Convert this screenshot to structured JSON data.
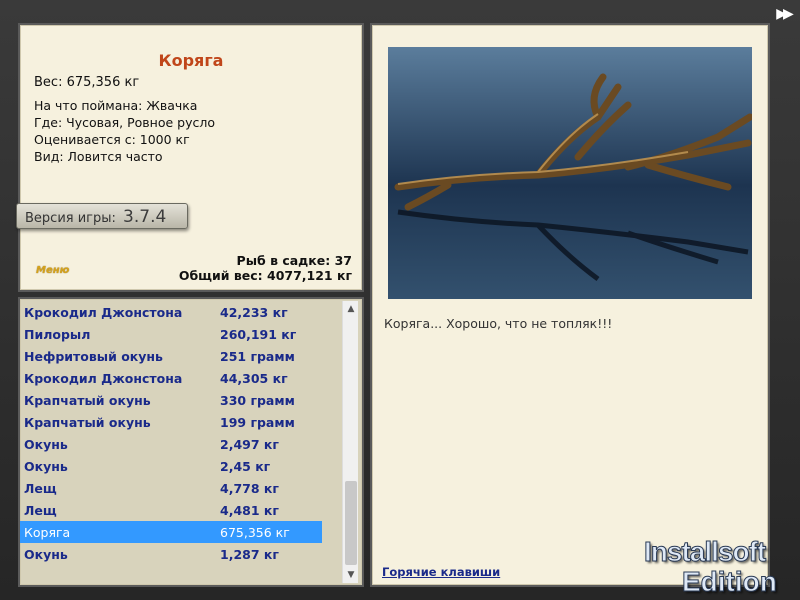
{
  "fish": {
    "name": "Коряга",
    "weight_line": "Вес: 675,356 кг",
    "attributes": [
      "На что поймана: Жвачка",
      "Где: Чусовая, Ровное русло",
      "Оценивается с: 1000 кг",
      "Вид: Ловится часто"
    ]
  },
  "version": {
    "label": "Версия игры:",
    "number": "3.7.4"
  },
  "menu_logo": "Меню",
  "stats": {
    "fish_count": "Рыб в садке: 37",
    "total_weight": "Общий вес: 4077,121 кг"
  },
  "catch_list": [
    {
      "name": "Крокодил Джонстона",
      "weight": "42,233 кг"
    },
    {
      "name": "Пилорыл",
      "weight": "260,191 кг"
    },
    {
      "name": "Нефритовый окунь",
      "weight": "251 грамм"
    },
    {
      "name": "Крокодил Джонстона",
      "weight": "44,305 кг"
    },
    {
      "name": "Крапчатый окунь",
      "weight": "330 грамм"
    },
    {
      "name": "Крапчатый окунь",
      "weight": "199 грамм"
    },
    {
      "name": "Окунь",
      "weight": "2,497 кг"
    },
    {
      "name": "Окунь",
      "weight": "2,45 кг"
    },
    {
      "name": "Лещ",
      "weight": "4,778 кг"
    },
    {
      "name": "Лещ",
      "weight": "4,481 кг"
    },
    {
      "name": "Коряга",
      "weight": "675,356 кг",
      "selected": true
    },
    {
      "name": "Окунь",
      "weight": "1,287 кг"
    }
  ],
  "detail": {
    "caption": "Коряга... Хорошо, что не топляк!!!",
    "hotkeys": "Горячие клавиши"
  },
  "watermark": {
    "line1": "Installsoft",
    "line2": "Edition"
  },
  "icons": {
    "fast_forward": "fast-forward-icon",
    "scroll_up": "scroll-up-icon",
    "scroll_down": "scroll-down-icon"
  },
  "colors": {
    "title": "#c0461a",
    "list_text": "#1a2a8a",
    "selection": "#3399ff",
    "panel_bg": "#f6f1de"
  }
}
